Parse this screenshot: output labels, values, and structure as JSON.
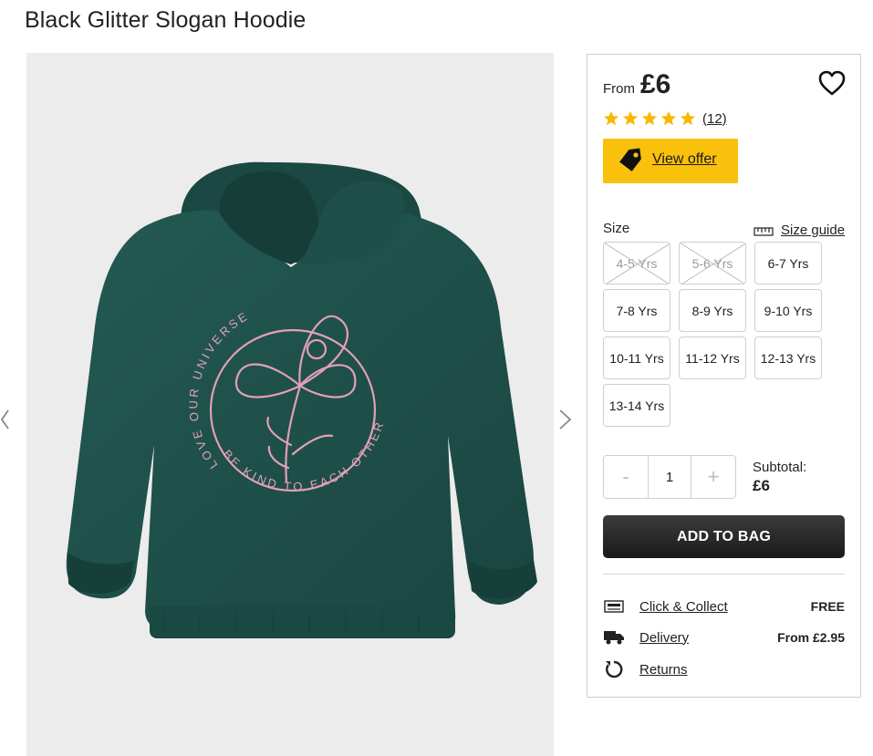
{
  "product": {
    "title": "Black Glitter Slogan Hoodie"
  },
  "gallery": {
    "slogan_top": "LOVE OUR UNIVERSE",
    "slogan_bottom": "BE KIND TO EACH OTHER",
    "prev_icon": "chevron-left-icon",
    "next_icon": "chevron-right-icon"
  },
  "price": {
    "from_label": "From",
    "value": "£6"
  },
  "rating": {
    "stars": 5,
    "review_count": "(12)"
  },
  "offer": {
    "label": "View offer"
  },
  "size": {
    "label": "Size",
    "guide_label": "Size guide",
    "options": [
      {
        "label": "4-5 Yrs",
        "available": false
      },
      {
        "label": "5-6 Yrs",
        "available": false
      },
      {
        "label": "6-7 Yrs",
        "available": true
      },
      {
        "label": "7-8 Yrs",
        "available": true
      },
      {
        "label": "8-9 Yrs",
        "available": true
      },
      {
        "label": "9-10 Yrs",
        "available": true
      },
      {
        "label": "10-11 Yrs",
        "available": true
      },
      {
        "label": "11-12 Yrs",
        "available": true
      },
      {
        "label": "12-13 Yrs",
        "available": true
      },
      {
        "label": "13-14 Yrs",
        "available": true
      }
    ]
  },
  "quantity": {
    "minus": "-",
    "value": "1",
    "plus": "+"
  },
  "subtotal": {
    "label": "Subtotal:",
    "value": "£6"
  },
  "cart": {
    "add_label": "ADD TO BAG"
  },
  "delivery": {
    "options": [
      {
        "label": "Click & Collect",
        "price": "FREE",
        "icon": "click-collect-icon"
      },
      {
        "label": "Delivery",
        "price": "From £2.95",
        "icon": "truck-icon"
      },
      {
        "label": "Returns",
        "price": "",
        "icon": "returns-icon"
      }
    ]
  },
  "colors": {
    "hoodie": "#1d4d47",
    "print": "#e8a3b8",
    "offer_yellow": "#f9c10c",
    "button_dark": "#222222"
  }
}
